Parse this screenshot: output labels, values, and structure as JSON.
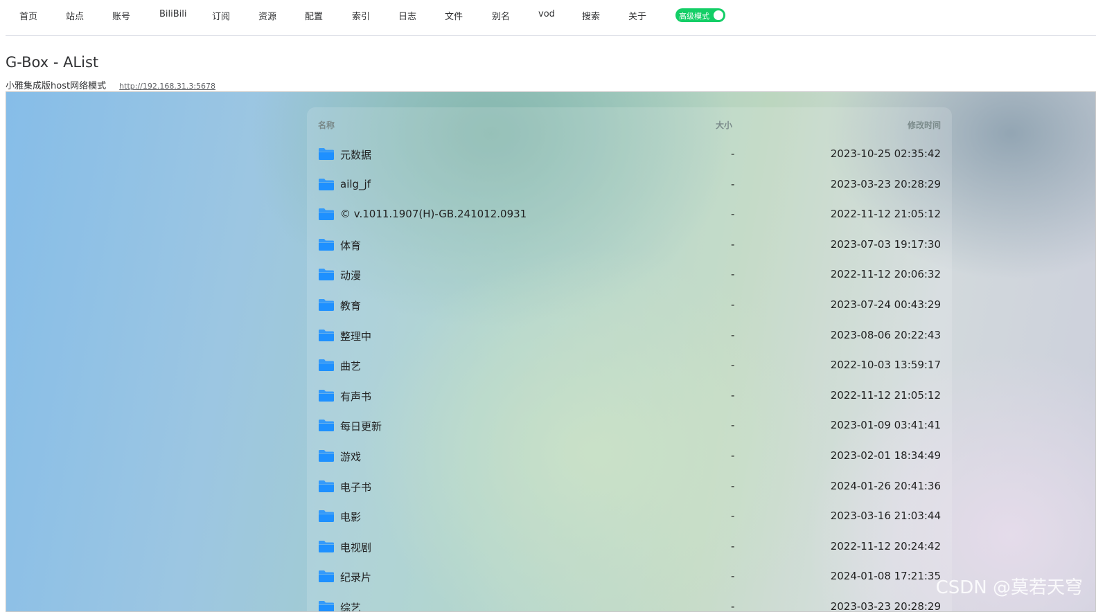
{
  "nav": {
    "items": [
      "首页",
      "站点",
      "账号",
      "BiliBili",
      "订阅",
      "资源",
      "配置",
      "索引",
      "日志",
      "文件",
      "别名",
      "vod",
      "搜索",
      "关于"
    ],
    "advanced_toggle": {
      "label": "高级模式",
      "on": true,
      "color": "#13ce66"
    }
  },
  "page": {
    "title": "G-Box - AList",
    "subtitle": "小雅集成版host网络模式",
    "link": "http://192.168.31.3:5678"
  },
  "file_list": {
    "headers": {
      "name": "名称",
      "size": "大小",
      "modified": "修改时间"
    },
    "folder_icon": "folder-icon",
    "folder_color": "#1e90ff",
    "rows": [
      {
        "name": "元数据",
        "size": "-",
        "modified": "2023-10-25 02:35:42"
      },
      {
        "name": "ailg_jf",
        "size": "-",
        "modified": "2023-03-23 20:28:29"
      },
      {
        "name": "© v.1011.1907(H)-GB.241012.0931",
        "size": "-",
        "modified": "2022-11-12 21:05:12"
      },
      {
        "name": "体育",
        "size": "-",
        "modified": "2023-07-03 19:17:30"
      },
      {
        "name": "动漫",
        "size": "-",
        "modified": "2022-11-12 20:06:32"
      },
      {
        "name": "教育",
        "size": "-",
        "modified": "2023-07-24 00:43:29"
      },
      {
        "name": "整理中",
        "size": "-",
        "modified": "2023-08-06 20:22:43"
      },
      {
        "name": "曲艺",
        "size": "-",
        "modified": "2022-10-03 13:59:17"
      },
      {
        "name": "有声书",
        "size": "-",
        "modified": "2022-11-12 21:05:12"
      },
      {
        "name": "每日更新",
        "size": "-",
        "modified": "2023-01-09 03:41:41"
      },
      {
        "name": "游戏",
        "size": "-",
        "modified": "2023-02-01 18:34:49"
      },
      {
        "name": "电子书",
        "size": "-",
        "modified": "2024-01-26 20:41:36"
      },
      {
        "name": "电影",
        "size": "-",
        "modified": "2023-03-16 21:03:44"
      },
      {
        "name": "电视剧",
        "size": "-",
        "modified": "2022-11-12 20:24:42"
      },
      {
        "name": "纪录片",
        "size": "-",
        "modified": "2024-01-08 17:21:35"
      },
      {
        "name": "综艺",
        "size": "-",
        "modified": "2023-03-23 20:28:29"
      }
    ]
  },
  "watermark": "CSDN @莫若天穹"
}
